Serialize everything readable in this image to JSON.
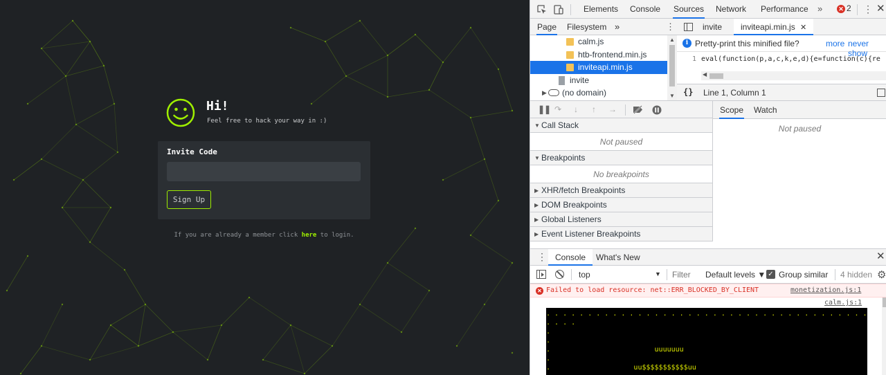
{
  "site": {
    "greeting": "Hi!",
    "subtitle": "Feel free to hack your way in :)",
    "invite_label": "Invite Code",
    "invite_value": "",
    "signup_label": "Sign Up",
    "login_note_pre": "If you are already a member click",
    "login_link": "here",
    "login_note_post": "to login.",
    "accent_color": "#9fef00",
    "background_color": "#1f2225"
  },
  "devtools": {
    "toolbar": {
      "inspect_icon": "inspect-element-icon",
      "device_icon": "device-toolbar-icon",
      "tabs": [
        "Elements",
        "Console",
        "Sources",
        "Network",
        "Performance"
      ],
      "active_tab": "Sources",
      "more": "»",
      "error_badge": "✕",
      "error_count": "2",
      "menu": "⋮",
      "close": "✕"
    },
    "navigator": {
      "tabs": [
        "Page",
        "Filesystem"
      ],
      "more": "»",
      "menu": "⋮",
      "tree": [
        {
          "label": "calm.js",
          "icon": "folder"
        },
        {
          "label": "htb-frontend.min.js",
          "icon": "folder"
        },
        {
          "label": "inviteapi.min.js",
          "icon": "folder",
          "selected": true
        },
        {
          "label": "invite",
          "icon": "file"
        },
        {
          "label": "(no domain)",
          "icon": "cloud"
        }
      ]
    },
    "editor": {
      "tabs": [
        "invite",
        "inviteapi.min.js"
      ],
      "active_tab": "inviteapi.min.js",
      "tab_close": "✕",
      "pretty_print_msg": "Pretty-print this minified file?",
      "pp_more": "more",
      "pp_never": "never show",
      "pp_close": "✕",
      "line_number": "1",
      "code": "eval(function(p,a,c,k,e,d){e=function(c){re",
      "braces": "{}",
      "cursor_status": "Line 1, Column 1"
    },
    "debugger": {
      "sections": [
        {
          "title": "Call Stack",
          "body": "Not paused"
        },
        {
          "title": "Breakpoints",
          "body": "No breakpoints"
        },
        {
          "title": "XHR/fetch Breakpoints"
        },
        {
          "title": "DOM Breakpoints"
        },
        {
          "title": "Global Listeners"
        },
        {
          "title": "Event Listener Breakpoints"
        }
      ]
    },
    "scope": {
      "tabs": [
        "Scope",
        "Watch"
      ],
      "active_tab": "Scope",
      "body": "Not paused"
    },
    "drawer": {
      "tabs": [
        "Console",
        "What's New"
      ],
      "active_tab": "Console",
      "close": "✕",
      "context": "top",
      "filter_placeholder": "Filter",
      "levels": "Default levels ▼",
      "group_similar": "Group similar",
      "group_checked": true,
      "hidden_count": "4 hidden",
      "settings_icon": "gear-icon",
      "error_message": "Failed to load resource: net::ERR_BLOCKED_BY_CLIENT",
      "error_source": "monetization.js:1",
      "log_source": "calm.js:1",
      "ascii_art": [
        ". . . . . . . . . . . . . . . . . . . . . . . . . . . . . . . . . . . . . . . . . . . . . . . .",
        ". . . .",
        ".",
        ".",
        ".                         uuuuuuu",
        ".",
        ".                    uu$$$$$$$$$$$uu"
      ]
    }
  }
}
